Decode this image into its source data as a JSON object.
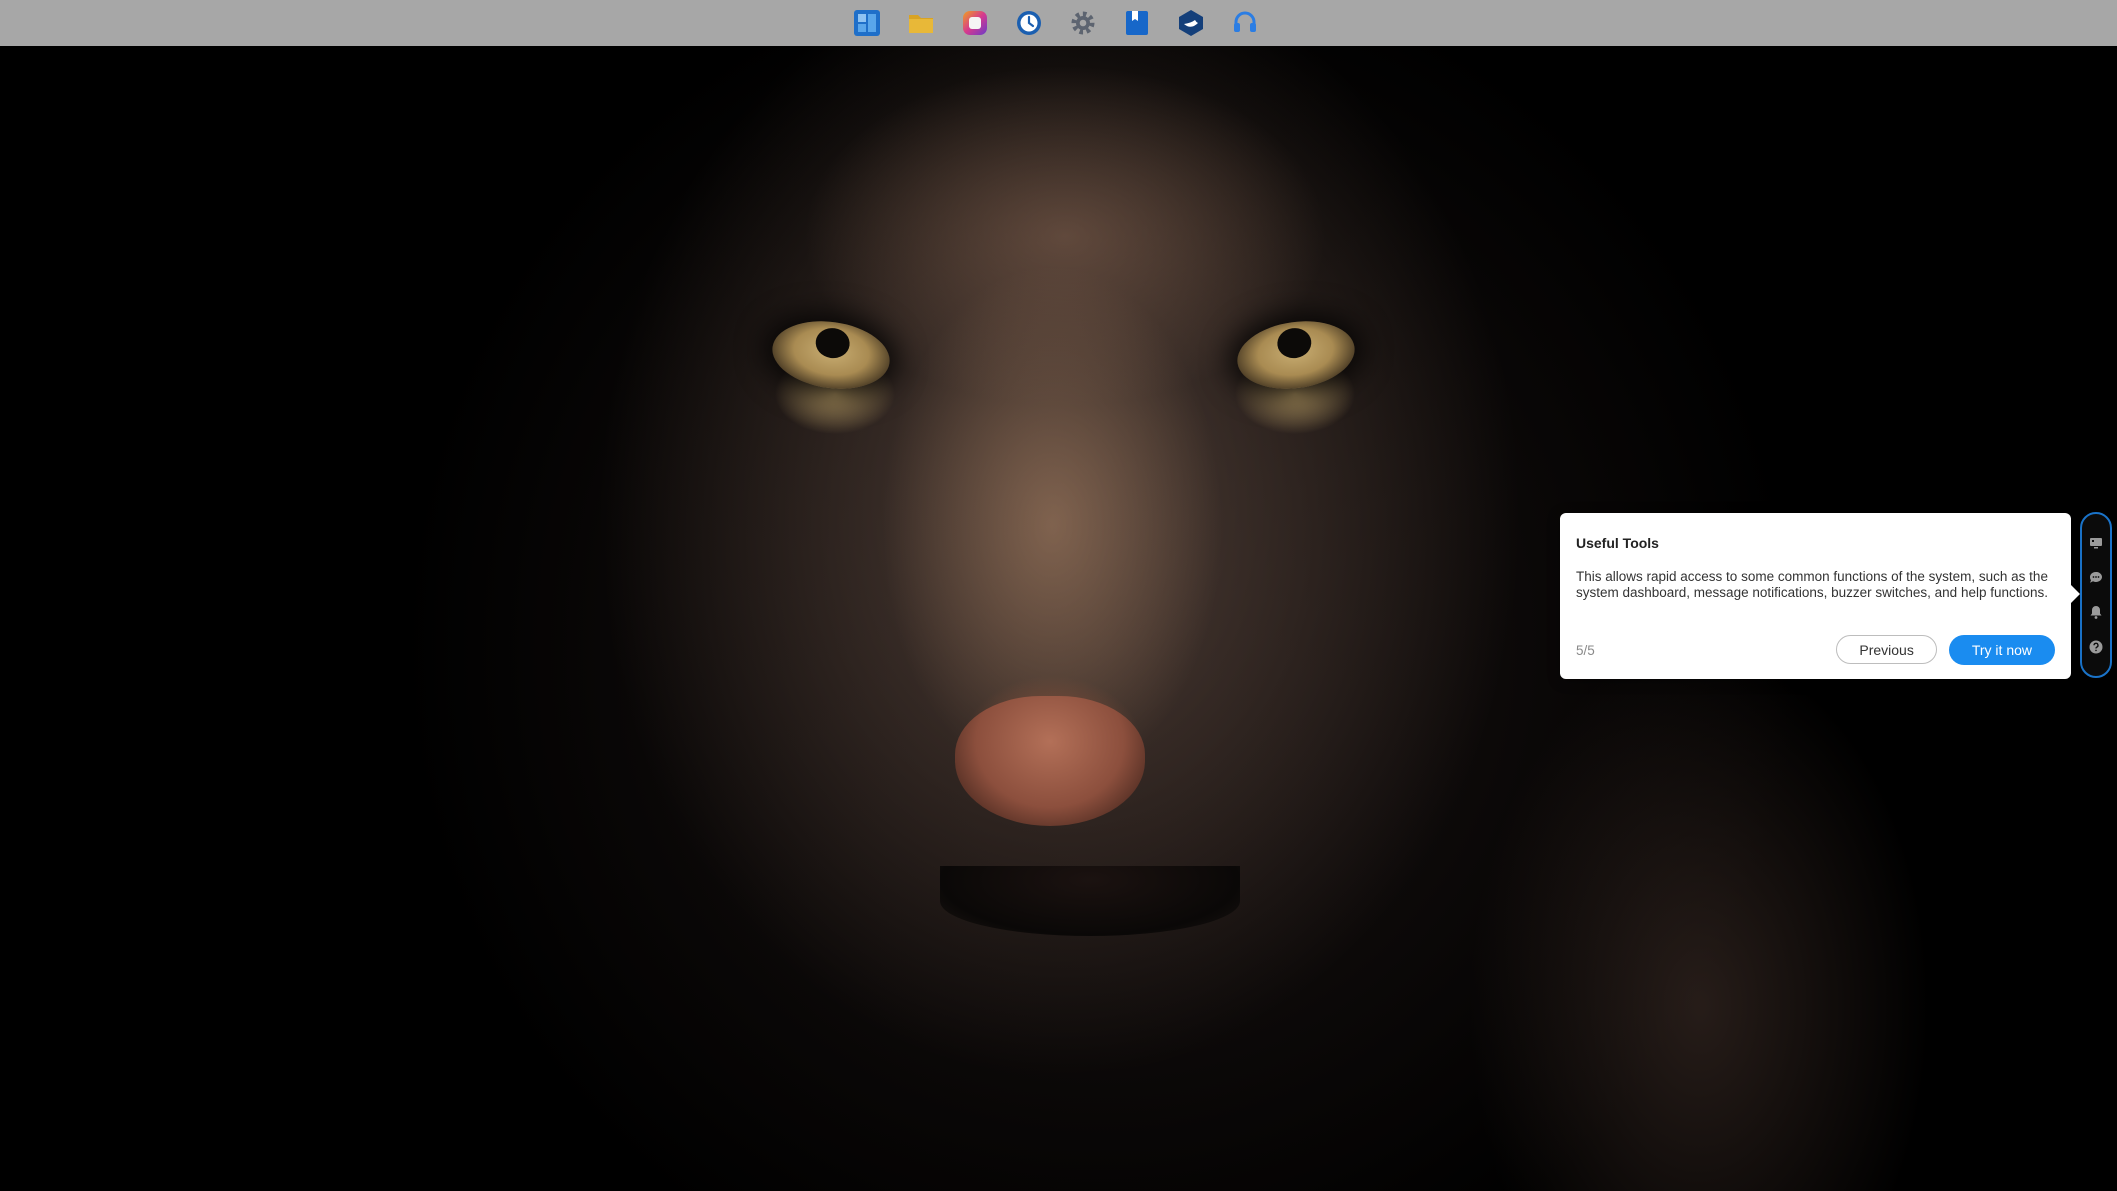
{
  "taskbar": {
    "apps": [
      {
        "icon": "dashboard-grid-icon",
        "color": "#1f6fc9"
      },
      {
        "icon": "folder-icon",
        "color": "#d9a323"
      },
      {
        "icon": "photos-app-icon",
        "color": "#c23aa0"
      },
      {
        "icon": "clock-backup-icon",
        "color": "#1b5fb0"
      },
      {
        "icon": "gear-settings-icon",
        "color": "#5d6470"
      },
      {
        "icon": "bookmark-app-icon",
        "color": "#1767c9"
      },
      {
        "icon": "docker-container-icon",
        "color": "#143f7a"
      },
      {
        "icon": "headset-support-icon",
        "color": "#2b7de3"
      }
    ]
  },
  "tool_strip": {
    "tools": [
      {
        "icon": "monitor-dashboard-icon"
      },
      {
        "icon": "chat-message-icon"
      },
      {
        "icon": "bell-notification-icon"
      },
      {
        "icon": "help-question-icon"
      }
    ],
    "border_color": "#1a73c9"
  },
  "guide": {
    "title": "Useful Tools",
    "description": "This allows rapid access to some common functions of the system, such as the system dashboard, message notifications, buzzer switches, and help functions.",
    "step": "5/5",
    "previous_label": "Previous",
    "try_label": "Try it now",
    "accent_color": "#1a8cf0"
  }
}
